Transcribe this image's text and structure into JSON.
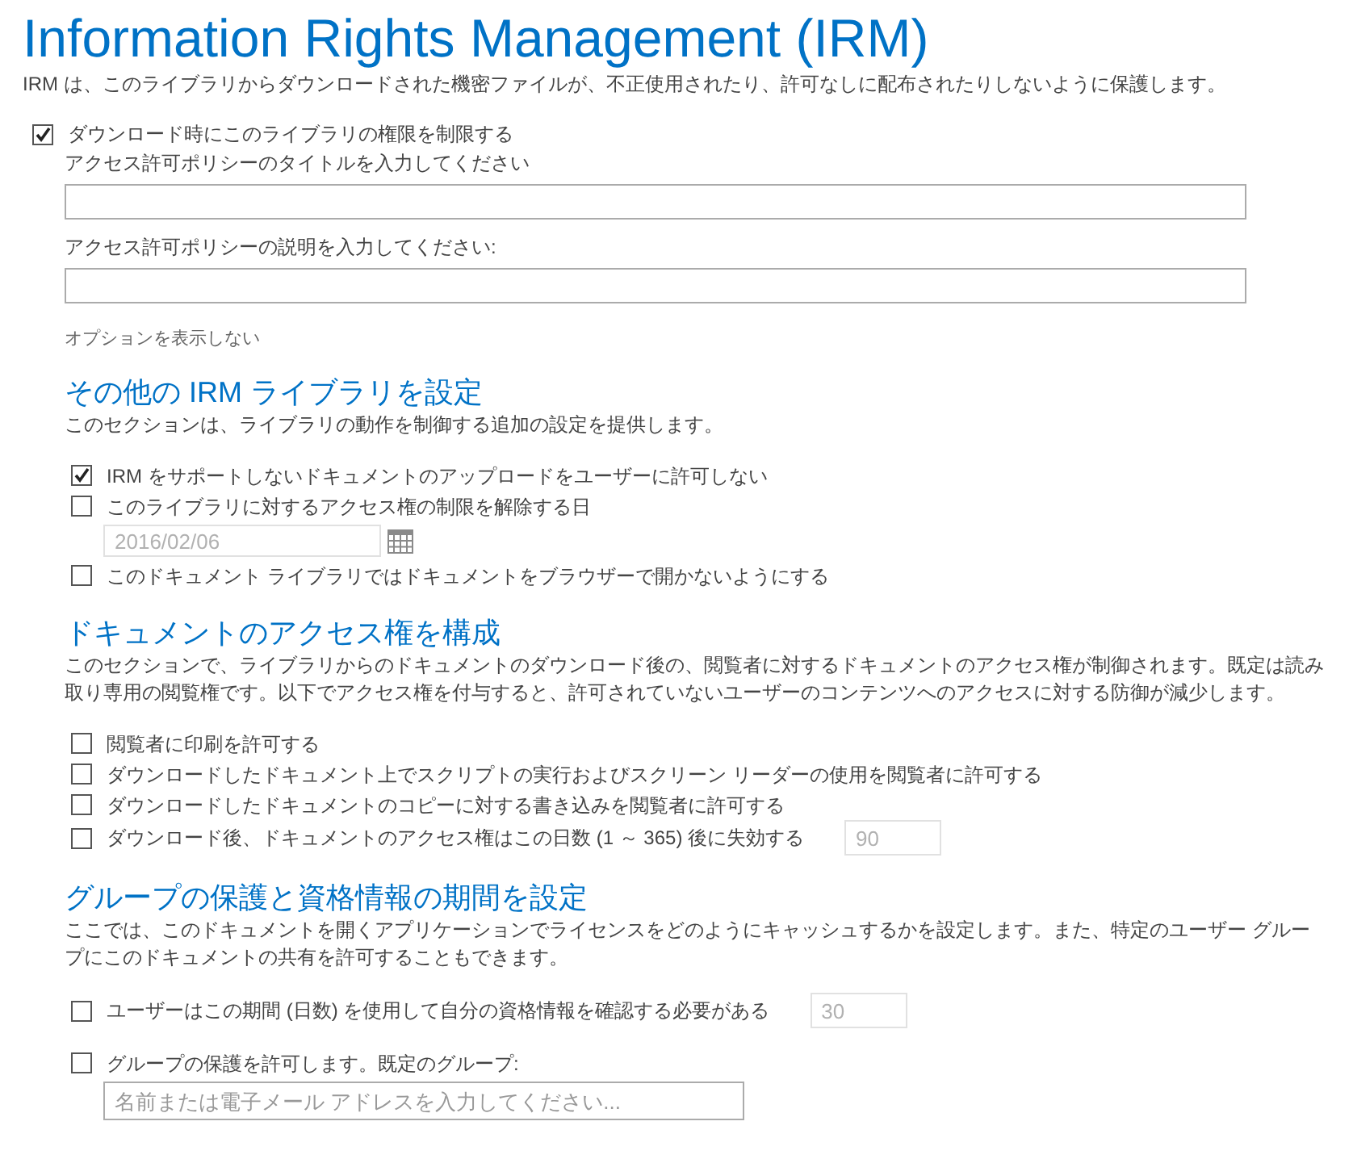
{
  "header": {
    "title": "Information Rights Management (IRM)",
    "description": "IRM は、このライブラリからダウンロードされた機密ファイルが、不正使用されたり、許可なしに配布されたりしないように保護します。"
  },
  "restrict": {
    "label": "ダウンロード時にこのライブラリの権限を制限する",
    "checked": true,
    "title_label": "アクセス許可ポリシーのタイトルを入力してください",
    "description_label": "アクセス許可ポリシーの説明を入力してください:",
    "toggle_link": "オプションを表示しない"
  },
  "sections": [
    {
      "title": "その他の IRM ライブラリを設定",
      "description": "このセクションは、ライブラリの動作を制御する追加の設定を提供します。",
      "options": [
        {
          "kind": "plain",
          "label": "IRM をサポートしないドキュメントのアップロードをユーザーに許可しない",
          "checked": true
        },
        {
          "kind": "date",
          "label": "このライブラリに対するアクセス権の制限を解除する日",
          "checked": false,
          "field": {
            "value": "2016/02/06",
            "disabled": true
          }
        },
        {
          "kind": "plain",
          "label": "このドキュメント ライブラリではドキュメントをブラウザーで開かないようにする",
          "checked": false
        }
      ]
    },
    {
      "title": "ドキュメントのアクセス権を構成",
      "description": "このセクションで、ライブラリからのドキュメントのダウンロード後の、閲覧者に対するドキュメントのアクセス権が制御されます。既定は読み取り専用の閲覧権です。以下でアクセス権を付与すると、許可されていないユーザーのコンテンツへのアクセスに対する防御が減少します。",
      "options": [
        {
          "kind": "plain",
          "label": "閲覧者に印刷を許可する",
          "checked": false
        },
        {
          "kind": "plain",
          "label": "ダウンロードしたドキュメント上でスクリプトの実行およびスクリーン リーダーの使用を閲覧者に許可する",
          "checked": false
        },
        {
          "kind": "plain",
          "label": "ダウンロードしたドキュメントのコピーに対する書き込みを閲覧者に許可する",
          "checked": false
        },
        {
          "kind": "number",
          "label": "ダウンロード後、ドキュメントのアクセス権はこの日数 (1 ～ 365) 後に失効する",
          "checked": false,
          "field": {
            "value": "90",
            "disabled": true
          }
        }
      ]
    },
    {
      "title": "グループの保護と資格情報の期間を設定",
      "description": "ここでは、このドキュメントを開くアプリケーションでライセンスをどのようにキャッシュするかを設定します。また、特定のユーザー グループにこのドキュメントの共有を許可することもできます。",
      "options": [
        {
          "kind": "number",
          "label": "ユーザーはこの期間 (日数) を使用して自分の資格情報を確認する必要がある",
          "checked": false,
          "field": {
            "value": "30",
            "disabled": true
          }
        },
        {
          "kind": "people",
          "label": "グループの保護を許可します。既定のグループ:",
          "checked": false,
          "field": {
            "placeholder": "名前または電子メール アドレスを入力してください...",
            "disabled": false
          }
        }
      ]
    }
  ]
}
